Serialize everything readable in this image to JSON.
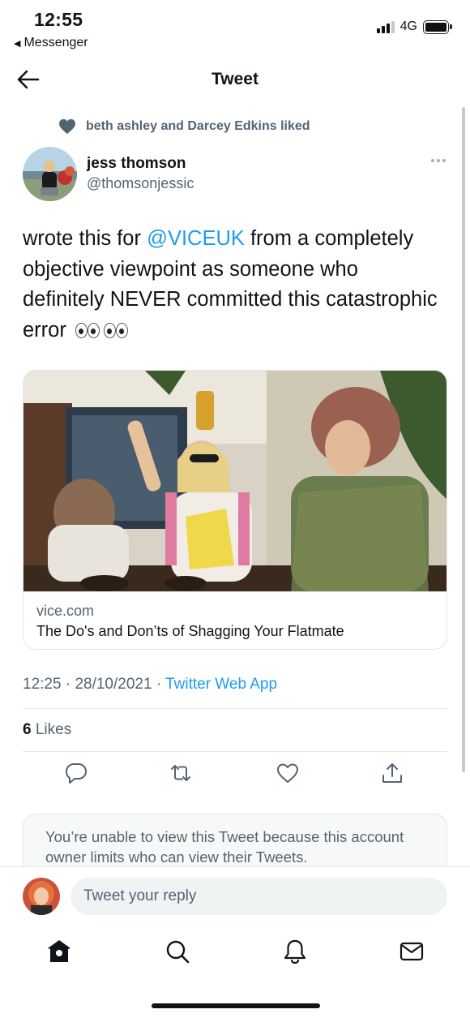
{
  "status_bar": {
    "time": "12:55",
    "back_app": "Messenger",
    "network": "4G"
  },
  "header": {
    "title": "Tweet"
  },
  "tweet": {
    "social_context": "beth ashley and Darcey Edkins liked",
    "author_name": "jess thomson",
    "author_handle": "@thomsonjessic",
    "text_before": "wrote this for ",
    "mention": "@VICEUK",
    "text_after": " from a completely objective viewpoint as someone who definitely NEVER committed this catastrophic error",
    "time": "12:25",
    "date": "28/10/2021",
    "source": "Twitter Web App",
    "likes_count": "6",
    "likes_label": "Likes"
  },
  "card": {
    "domain": "vice.com",
    "title": "The Do's and Don’ts of Shagging Your Flatmate"
  },
  "notice": {
    "text": "You’re unable to view this Tweet because this account owner limits who can view their Tweets."
  },
  "reply": {
    "placeholder": "Tweet your reply"
  },
  "colors": {
    "accent": "#1d9bf0",
    "secondary_text": "#536471",
    "primary_text": "#0f1419"
  }
}
